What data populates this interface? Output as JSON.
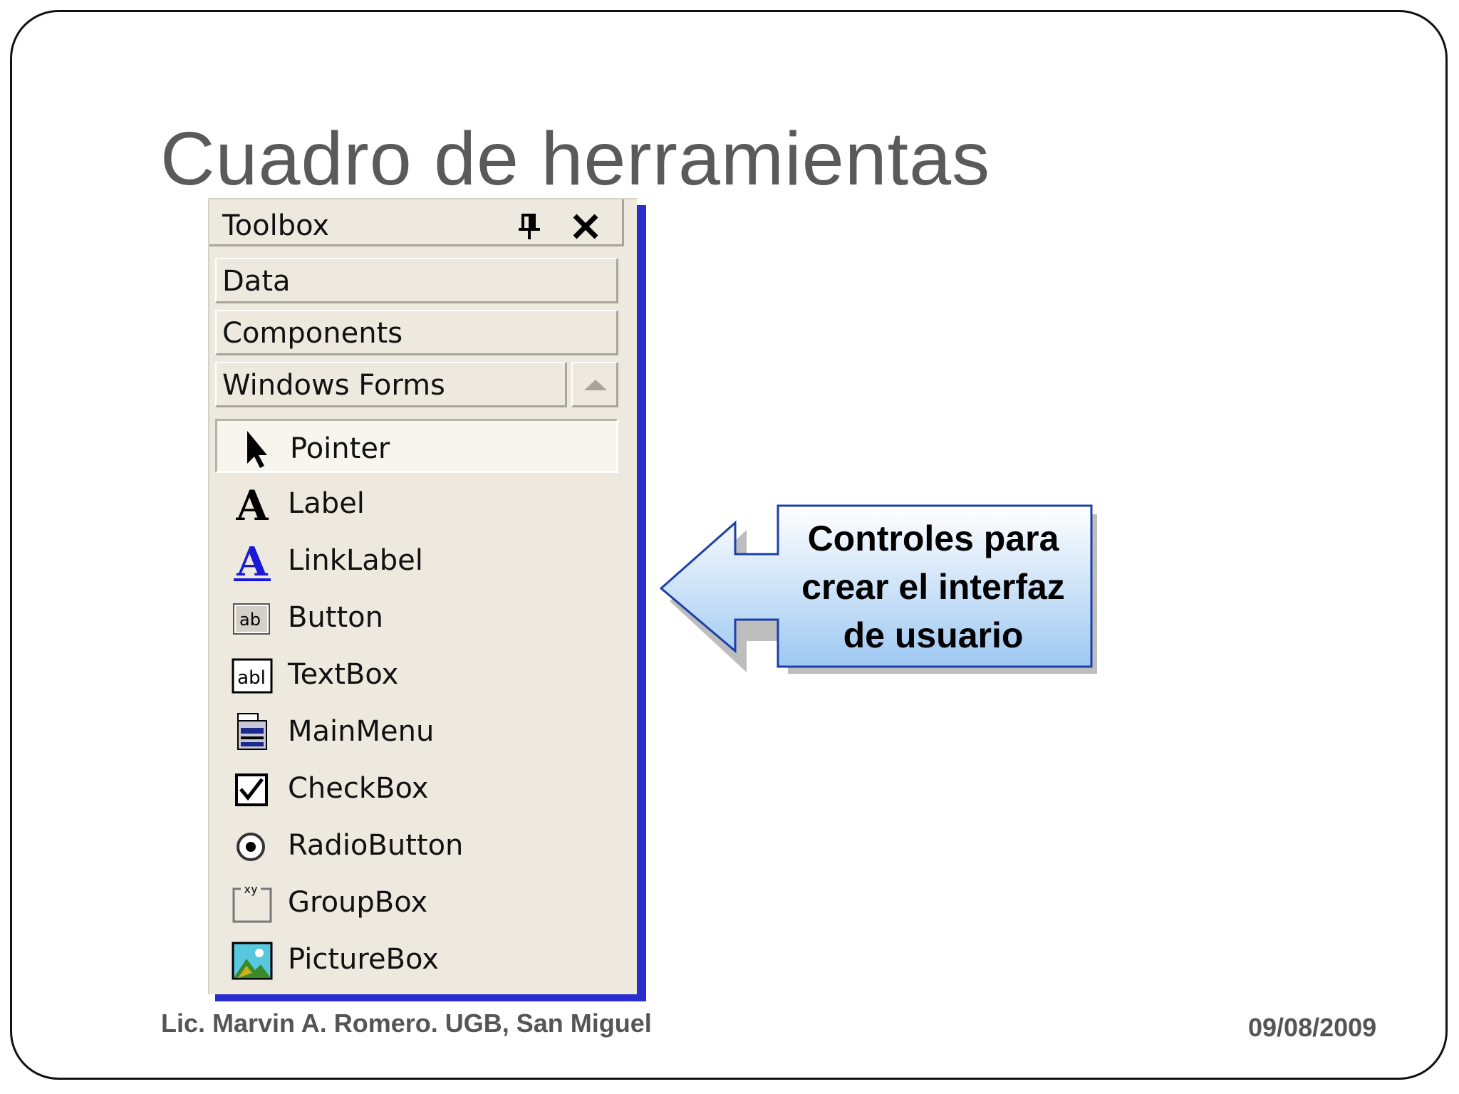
{
  "slide": {
    "title": "Cuadro de herramientas",
    "footer_left": "Lic. Marvin A. Romero. UGB, San Miguel",
    "footer_right": "09/08/2009"
  },
  "toolbox": {
    "title": "Toolbox",
    "header_icons": [
      "pin-icon",
      "close-icon"
    ],
    "categories": [
      {
        "label": "Data"
      },
      {
        "label": "Components"
      },
      {
        "label": "Windows Forms"
      }
    ],
    "items": [
      {
        "label": "Pointer",
        "icon": "pointer-icon",
        "selected": true
      },
      {
        "label": "Label",
        "icon": "label-icon"
      },
      {
        "label": "LinkLabel",
        "icon": "linklabel-icon"
      },
      {
        "label": "Button",
        "icon": "button-icon"
      },
      {
        "label": "TextBox",
        "icon": "textbox-icon"
      },
      {
        "label": "MainMenu",
        "icon": "mainmenu-icon"
      },
      {
        "label": "CheckBox",
        "icon": "checkbox-icon"
      },
      {
        "label": "RadioButton",
        "icon": "radiobutton-icon"
      },
      {
        "label": "GroupBox",
        "icon": "groupbox-icon"
      },
      {
        "label": "PictureBox",
        "icon": "picturebox-icon"
      }
    ]
  },
  "callout": {
    "line1": "Controles para",
    "line2": "crear el interfaz",
    "line3": "de usuario"
  },
  "colors": {
    "toolbox_bg": "#ede9df",
    "toolbox_shadow": "#2c2ccf",
    "callout_border": "#1c3fa8",
    "callout_fill_light": "#ffffff",
    "callout_fill_dark": "#9ec8f2",
    "title_text": "#5a5a5a"
  }
}
